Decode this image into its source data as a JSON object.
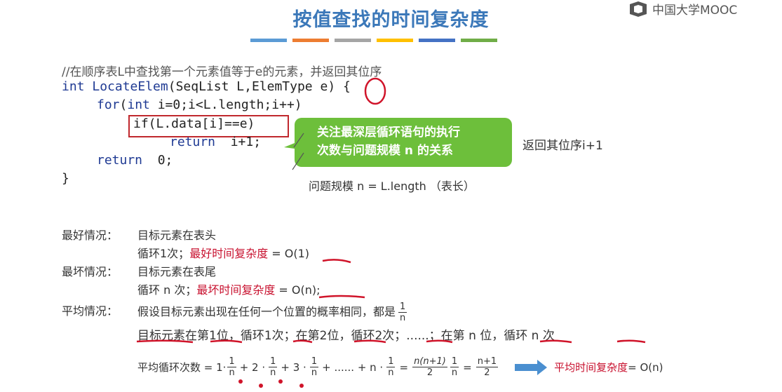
{
  "slide": {
    "title": "按值查找的时间复杂度",
    "accent_bars": [
      "#5b9bd5",
      "#ed7d31",
      "#a5a5a5",
      "#ffc000",
      "#4472c4",
      "#70ad47"
    ]
  },
  "logo": {
    "text": "中国大学MOOC",
    "icon": "mooc-logo-icon"
  },
  "code": {
    "comment": "//在顺序表L中查找第一个元素值等于e的元素，并返回其位序",
    "line1_kw": "int",
    "line1_fn": "LocateElem",
    "line1_args_a": "(SeqList L,ElemType ",
    "line1_e": "e",
    "line1_args_b": ") {",
    "line2_kw": "for",
    "line2_a": "(",
    "line2_int": "int",
    "line2_b": " i=0;i<L.length;i++)",
    "line3": "if(L.data[i]==e)",
    "line4_kw": "return",
    "line4_val": "  i+1;",
    "line5_kw": "return",
    "line5_val": "  0;",
    "line6": "}"
  },
  "callout": {
    "line1": "关注最深层循环语句的执行",
    "line2": "次数与问题规模 n 的关系"
  },
  "notes": {
    "return_note": "返回其位序i+1",
    "problem_size": "问题规模 n = L.length （表长）"
  },
  "best": {
    "label": "最好情况：",
    "desc": "目标元素在表头",
    "loop": "循环1次；",
    "red": "最好时间复杂度",
    "eq": " = O(1)"
  },
  "worst": {
    "label": "最坏情况：",
    "desc": "目标元素在表尾",
    "loop": "循环 n 次；",
    "red": "最坏时间复杂度",
    "eq": " = O(n);"
  },
  "avg": {
    "label": "平均情况：",
    "desc": "假设目标元素出现在任何一个位置的概率相同，都是",
    "frac_n": "1",
    "frac_d": "n",
    "line2": "目标元素在第1位，循环1次；在第2位，循环2次；......；在第 n 位，循环 n 次",
    "formula_label": "平均循环次数 = 1·",
    "f1n": "1",
    "f1d": "n",
    "plus2": "+ 2 ·",
    "f2n": "1",
    "f2d": "n",
    "plus3": "+ 3 ·",
    "f3n": "1",
    "f3d": "n",
    "plusdots": "+ ...... + n ·",
    "f4n": "1",
    "f4d": "n",
    "eq1": "=",
    "f5n": "n(n+1)",
    "f5d": "2",
    "f6n": "1",
    "f6d": "n",
    "eq2": "=",
    "f7n": "n+1",
    "f7d": "2",
    "result_red": "平均时间复杂度",
    "result_eq": " = O(n)"
  }
}
